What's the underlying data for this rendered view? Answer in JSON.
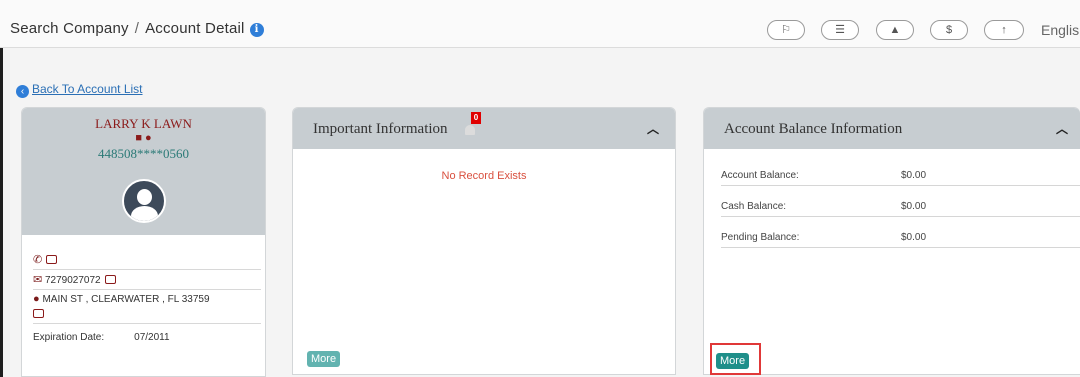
{
  "breadcrumb": {
    "parent": "Search Company",
    "separator": "/",
    "current": "Account Detail",
    "info_icon": "i"
  },
  "toolbar": {
    "pills": [
      {
        "icon": "flag-icon",
        "glyph": "⚐"
      },
      {
        "icon": "list-icon",
        "glyph": "☰"
      },
      {
        "icon": "bell-icon",
        "glyph": "▲"
      },
      {
        "icon": "dollar-icon",
        "glyph": "$"
      },
      {
        "icon": "upload-icon",
        "glyph": "↑"
      }
    ],
    "language": "English"
  },
  "back_link": "Back To Account List",
  "customer": {
    "name": "LARRY K LAWN",
    "account": "448508****0560",
    "phone_icon": "✆",
    "email": "7279027072",
    "address": "MAIN ST , CLEARWATER , FL 33759",
    "expiration_label": "Expiration Date:",
    "expiration_value": "07/2011"
  },
  "important": {
    "title": "Important Information",
    "badge": "0",
    "empty_text": "No Record Exists",
    "more_label": "More"
  },
  "balance": {
    "title": "Account Balance Information",
    "rows": [
      {
        "label": "Account Balance:",
        "value": "$0.00"
      },
      {
        "label": "Cash Balance:",
        "value": "$0.00"
      },
      {
        "label": "Pending Balance:",
        "value": "$0.00"
      }
    ],
    "more_label": "More"
  },
  "colors": {
    "accent_teal": "#1f8f8a",
    "header_gray": "#c7cdd1",
    "name_red": "#8b1a1a",
    "highlight": "#e03838"
  }
}
